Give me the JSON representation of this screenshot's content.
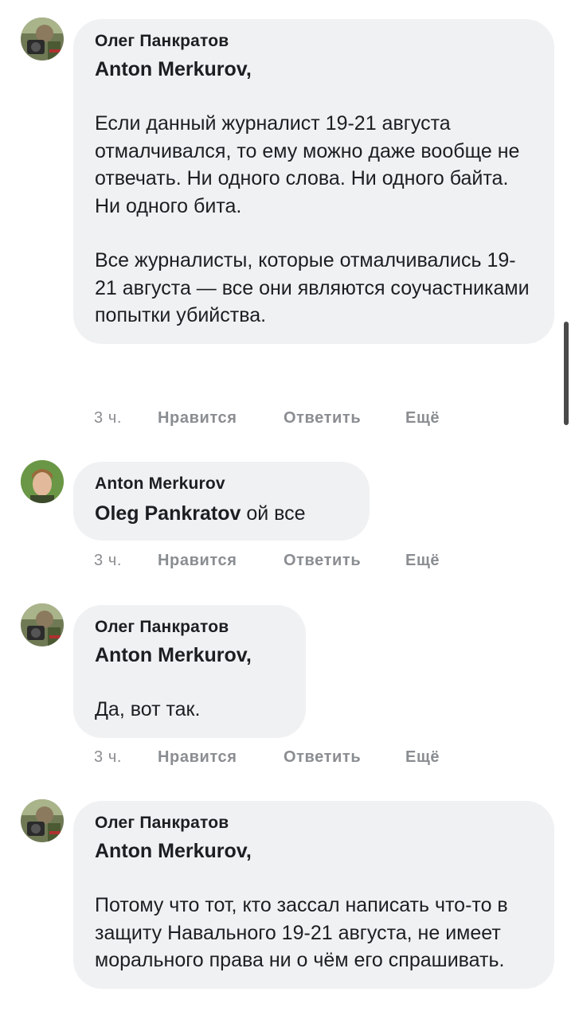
{
  "comments": [
    {
      "author": "Олег Панкратов",
      "reply_to": "Anton Merkurov,",
      "paragraphs": [
        "Если данный журналист 19-21 августа отмалчивался, то ему можно даже вообще не отвечать. Ни одного слова. Ни одного байта. Ни одного бита.",
        "Все журналисты, которые отмалчивались 19-21 августа — все они являются соучастниками попытки убийства."
      ],
      "actions": {
        "time": "3 ч.",
        "like": "Нравится",
        "reply": "Ответить",
        "more": "Ещё"
      }
    },
    {
      "author": "Anton Merkurov",
      "mention": "Oleg Pankratov",
      "text": " ой все",
      "actions": {
        "time": "3 ч.",
        "like": "Нравится",
        "reply": "Ответить",
        "more": "Ещё"
      }
    },
    {
      "author": "Олег Панкратов",
      "reply_to": "Anton Merkurov,",
      "paragraphs": [
        "Да, вот так."
      ],
      "actions": {
        "time": "3 ч.",
        "like": "Нравится",
        "reply": "Ответить",
        "more": "Ещё"
      }
    },
    {
      "author": "Олег Панкратов",
      "reply_to": "Anton Merkurov,",
      "paragraphs": [
        "Потому что тот, кто зассал написать что-то в защиту Навального 19-21 августа, не имеет морального права ни о чём его спрашивать."
      ]
    }
  ],
  "colors": {
    "bubble": "#f0f1f3",
    "text": "#1c1e21",
    "meta": "#8a8d91"
  }
}
